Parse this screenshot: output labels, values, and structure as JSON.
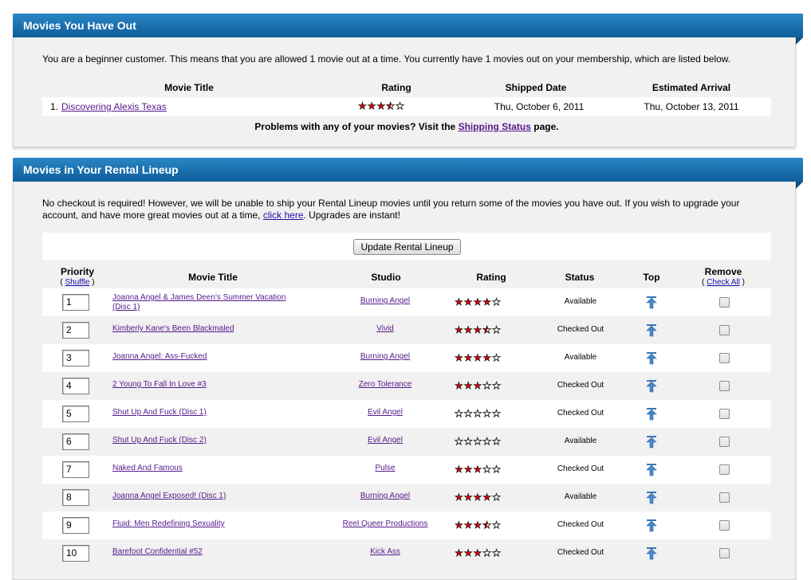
{
  "out_section": {
    "title": "Movies You Have Out",
    "intro": "You are a beginner customer. This means that you are allowed 1 movie out at a time. You currently have 1 movies out on your membership, which are listed below.",
    "headers": {
      "title": "Movie Title",
      "rating": "Rating",
      "shipped": "Shipped Date",
      "arrival": "Estimated Arrival"
    },
    "rows": [
      {
        "num": "1.",
        "title": "Discovering Alexis Texas",
        "rating": 3.5,
        "shipped": "Thu, October 6, 2011",
        "arrival": "Thu, October 13, 2011"
      }
    ],
    "problems_prefix": "Problems with any of your movies? Visit the ",
    "problems_link": "Shipping Status",
    "problems_suffix": " page."
  },
  "lineup_section": {
    "title": "Movies in Your Rental Lineup",
    "intro_part1": "No checkout is required! However, we will be unable to ship your Rental Lineup movies until you return some of the movies you have out. If you wish to upgrade your account, and have more great movies out at a time, ",
    "intro_link": "click here",
    "intro_part2": ". Upgrades are instant!",
    "update_button": "Update Rental Lineup",
    "headers": {
      "priority": "Priority",
      "shuffle_open": "( ",
      "shuffle": "Shuffle",
      "shuffle_close": " )",
      "title": "Movie Title",
      "studio": "Studio",
      "rating": "Rating",
      "status": "Status",
      "top": "Top",
      "remove": "Remove",
      "checkall_open": "( ",
      "checkall": "Check All",
      "checkall_close": " )"
    },
    "rows": [
      {
        "priority": "1",
        "title_line1": "Joanna Angel & James Deen's Summer Vacation",
        "title_line2": "(Disc 1)",
        "studio": "Burning Angel",
        "rating": 4,
        "status": "Available"
      },
      {
        "priority": "2",
        "title_line1": "Kimberly Kane's Been Blackmaled",
        "title_line2": "",
        "studio": "Vivid",
        "rating": 3.5,
        "status": "Checked Out"
      },
      {
        "priority": "3",
        "title_line1": "Joanna Angel: Ass-Fucked",
        "title_line2": "",
        "studio": "Burning Angel",
        "rating": 4,
        "status": "Available"
      },
      {
        "priority": "4",
        "title_line1": "2 Young To Fall In Love #3",
        "title_line2": "",
        "studio": "Zero Tolerance",
        "rating": 3,
        "status": "Checked Out"
      },
      {
        "priority": "5",
        "title_line1": "Shut Up And Fuck (Disc 1)",
        "title_line2": "",
        "studio": "Evil Angel",
        "rating": 0,
        "status": "Checked Out"
      },
      {
        "priority": "6",
        "title_line1": "Shut Up And Fuck (Disc 2)",
        "title_line2": "",
        "studio": "Evil Angel",
        "rating": 0,
        "status": "Available"
      },
      {
        "priority": "7",
        "title_line1": "Naked And Famous",
        "title_line2": "",
        "studio": "Pulse",
        "rating": 3,
        "status": "Checked Out"
      },
      {
        "priority": "8",
        "title_line1": "Joanna Angel Exposed! (Disc 1)",
        "title_line2": "",
        "studio": "Burning Angel",
        "rating": 4,
        "status": "Available"
      },
      {
        "priority": "9",
        "title_line1": "Fluid: Men Redefining Sexuality",
        "title_line2": "",
        "studio": "Reel Queer Productions",
        "rating": 3.5,
        "status": "Checked Out"
      },
      {
        "priority": "10",
        "title_line1": "Barefoot Confidential #52",
        "title_line2": "",
        "studio": "Kick Ass",
        "rating": 3,
        "status": "Checked Out"
      }
    ]
  },
  "colors": {
    "bar": "#1a6fae",
    "star": "#e00000",
    "link_visited": "#551a8b",
    "link": "#1a0dab",
    "panel": "#f1f1f1"
  }
}
